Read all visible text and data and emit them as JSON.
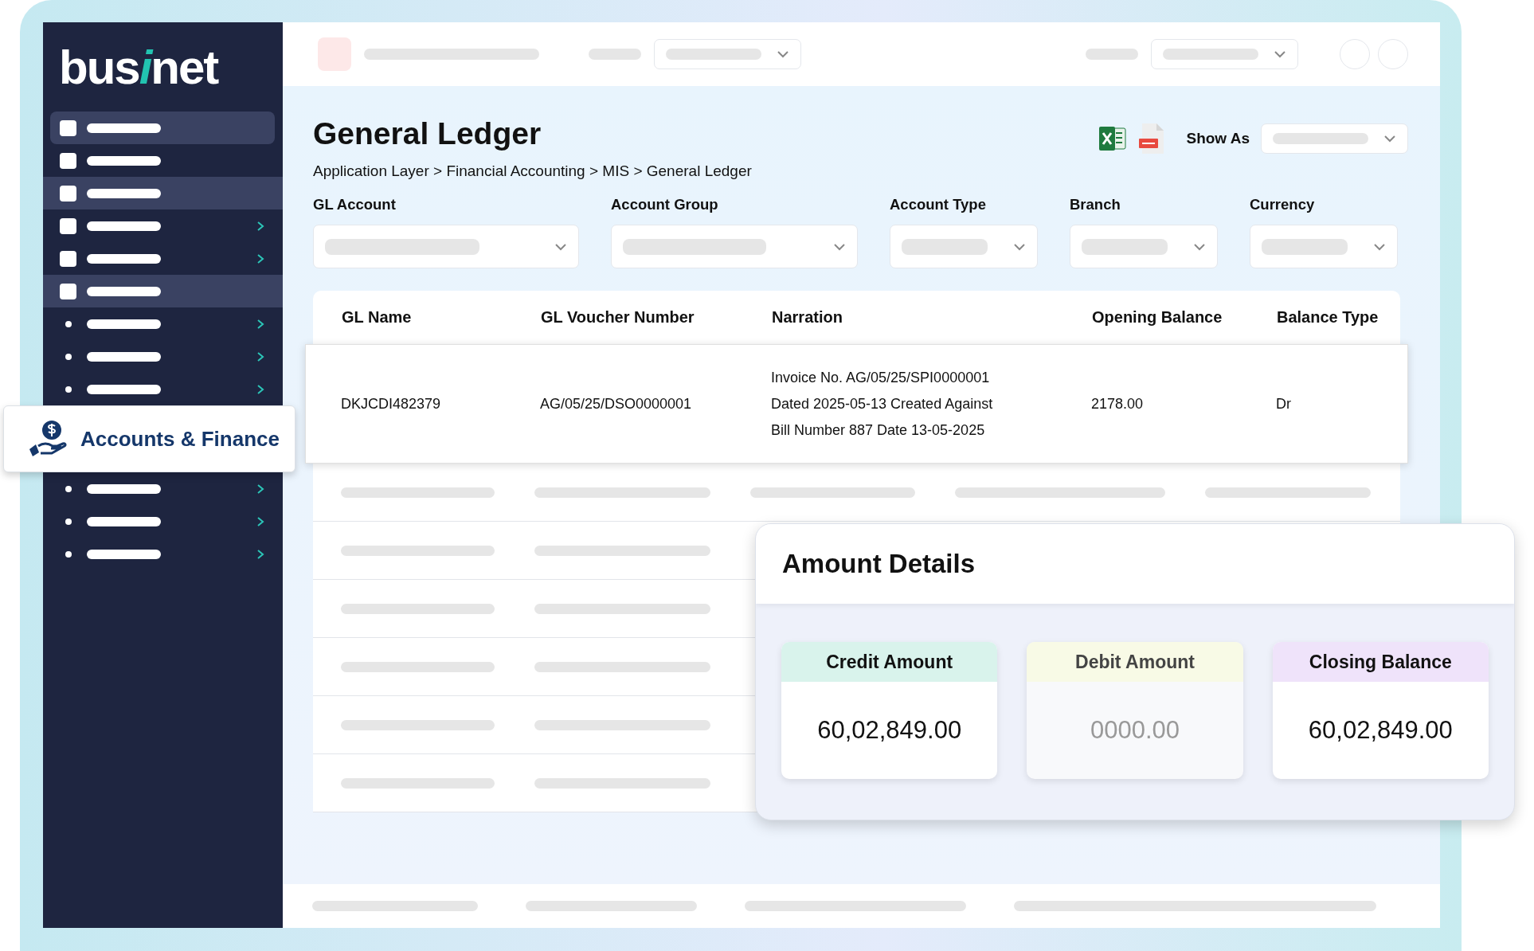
{
  "logo": {
    "parts": [
      "bus",
      "i",
      "net"
    ]
  },
  "sidebar": {
    "menu": [
      {
        "kind": "square",
        "highlighted": true,
        "rounded": true,
        "submenu": false
      },
      {
        "kind": "square",
        "highlighted": false,
        "rounded": false,
        "submenu": false
      },
      {
        "kind": "square",
        "highlighted": true,
        "rounded": false,
        "submenu": false
      },
      {
        "kind": "square",
        "highlighted": false,
        "rounded": false,
        "submenu": true
      },
      {
        "kind": "square",
        "highlighted": false,
        "rounded": false,
        "submenu": true
      },
      {
        "kind": "square",
        "highlighted": true,
        "rounded": false,
        "submenu": false
      },
      {
        "kind": "dot",
        "highlighted": false,
        "rounded": false,
        "submenu": true
      },
      {
        "kind": "dot",
        "highlighted": false,
        "rounded": false,
        "submenu": true
      },
      {
        "kind": "dot",
        "highlighted": false,
        "rounded": false,
        "submenu": true
      }
    ],
    "featured": {
      "label": "Accounts & Finance"
    },
    "menu_after": [
      {
        "kind": "dot",
        "highlighted": false,
        "rounded": false,
        "submenu": true
      },
      {
        "kind": "dot",
        "highlighted": false,
        "rounded": false,
        "submenu": true
      },
      {
        "kind": "dot",
        "highlighted": false,
        "rounded": false,
        "submenu": true
      }
    ]
  },
  "page": {
    "title": "General Ledger",
    "breadcrumb": "Application Layer > Financial Accounting > MIS > General Ledger",
    "show_as_label": "Show As"
  },
  "filters": [
    {
      "label": "GL Account"
    },
    {
      "label": "Account Group"
    },
    {
      "label": "Account Type"
    },
    {
      "label": "Branch"
    },
    {
      "label": "Currency"
    }
  ],
  "table": {
    "columns": [
      "GL Name",
      "GL Voucher Number",
      "Narration",
      "Opening Balance",
      "Balance Type"
    ],
    "rows": [
      {
        "cells": [
          "DKJCDI482379",
          "AG/05/25/DSO0000001",
          "Invoice No. AG/05/25/SPI0000001\nDated 2025-05-13 Created Against\nBill Number 887 Date 13-05-2025",
          "2178.00",
          "Dr"
        ]
      }
    ]
  },
  "amount_details": {
    "title": "Amount Details",
    "cards": [
      {
        "label": "Credit Amount",
        "value": "60,02,849.00",
        "color": "#d9f3ec",
        "dimmed": false
      },
      {
        "label": "Debit Amount",
        "value": "0000.00",
        "color": "#f8fae6",
        "dimmed": true
      },
      {
        "label": "Closing Balance",
        "value": "60,02,849.00",
        "color": "#efe3fa",
        "dimmed": false
      }
    ]
  }
}
